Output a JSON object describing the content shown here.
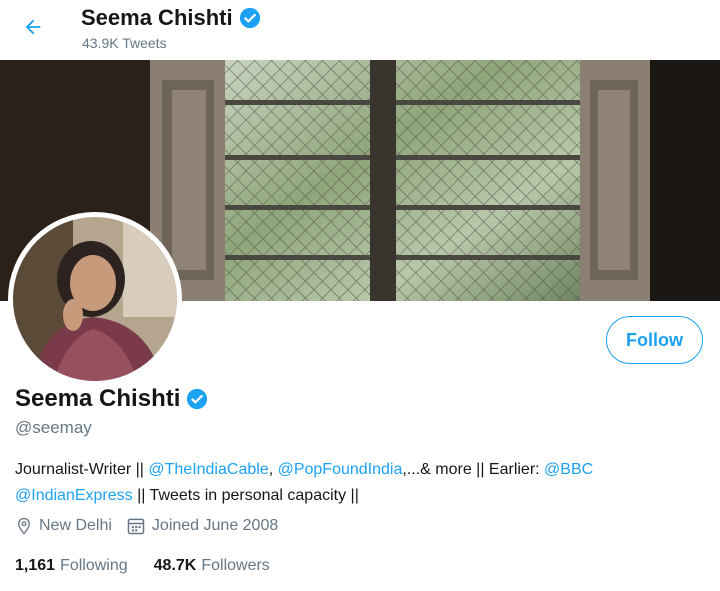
{
  "header": {
    "name": "Seema Chishti",
    "tweet_count": "43.9K Tweets",
    "back_icon": "arrow-left-icon"
  },
  "profile": {
    "display_name": "Seema Chishti",
    "handle": "@seemay",
    "verified_icon": "verified-badge-icon",
    "follow_label": "Follow",
    "bio": {
      "part1": "Journalist-Writer || ",
      "mention1": "@TheIndiaCable",
      "sep1": ", ",
      "mention2": "@PopFoundIndia",
      "part2": ",...& more || Earlier: ",
      "mention3": "@BBC",
      "mention4": "@IndianExpress",
      "part3": " || Tweets in personal capacity ||"
    },
    "location": "New Delhi",
    "joined": "Joined June 2008",
    "following_count": "1,161",
    "following_label": "Following",
    "followers_count": "48.7K",
    "followers_label": "Followers"
  },
  "colors": {
    "accent": "#1da1f2",
    "secondary_text": "#657786",
    "primary_text": "#14171a"
  }
}
